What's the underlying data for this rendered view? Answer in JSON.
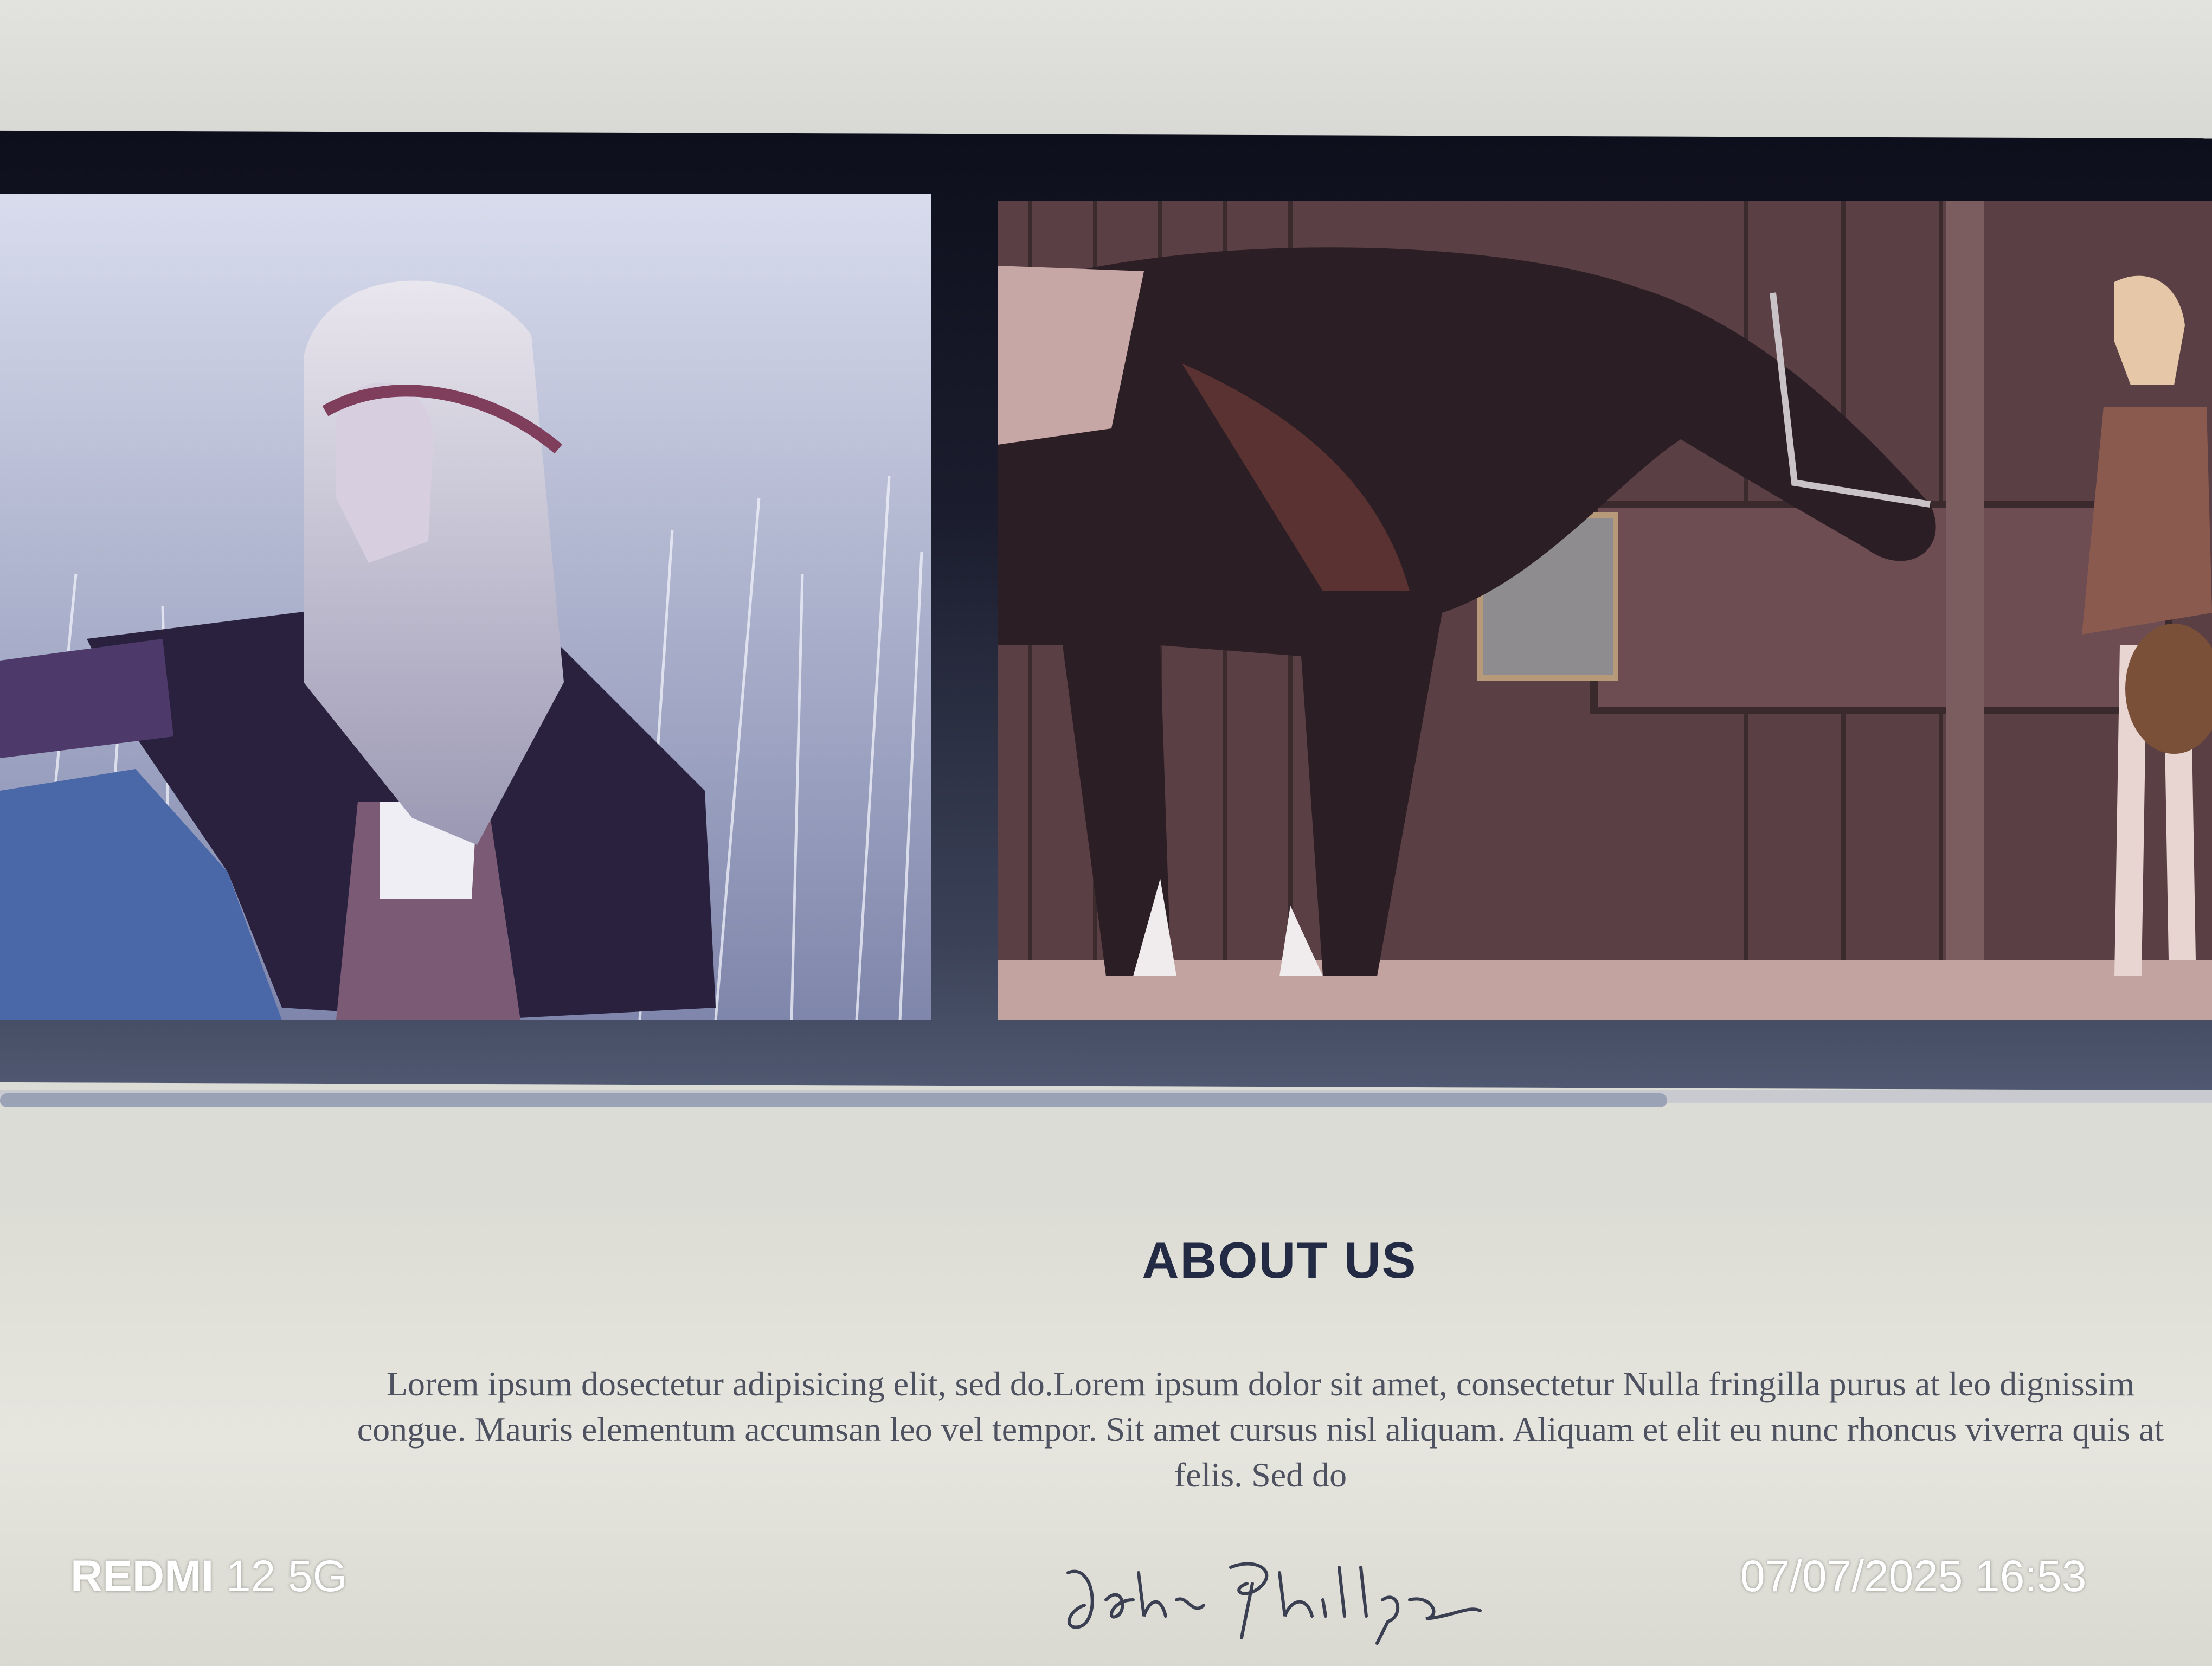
{
  "about": {
    "title": "ABOUT US",
    "body": "Lorem ipsum dosectetur adipisicing elit, sed do.Lorem ipsum dolor sit amet, consectetur Nulla fringilla purus at leo dignissim congue. Mauris elementum accumsan leo vel tempor. Sit amet cursus nisl aliquam. Aliquam et elit eu nunc rhoncus viverra quis at felis. Sed do",
    "signature": "John Phillips"
  },
  "overlay": {
    "device_brand": "REDMI",
    "device_model": "12 5G",
    "timestamp": "07/07/2025 16:53"
  },
  "colors": {
    "banner_dark": "#0e0f1c",
    "title": "#232a44",
    "body_text": "#4e5260",
    "scrollbar_thumb": "#9aa2b6"
  }
}
